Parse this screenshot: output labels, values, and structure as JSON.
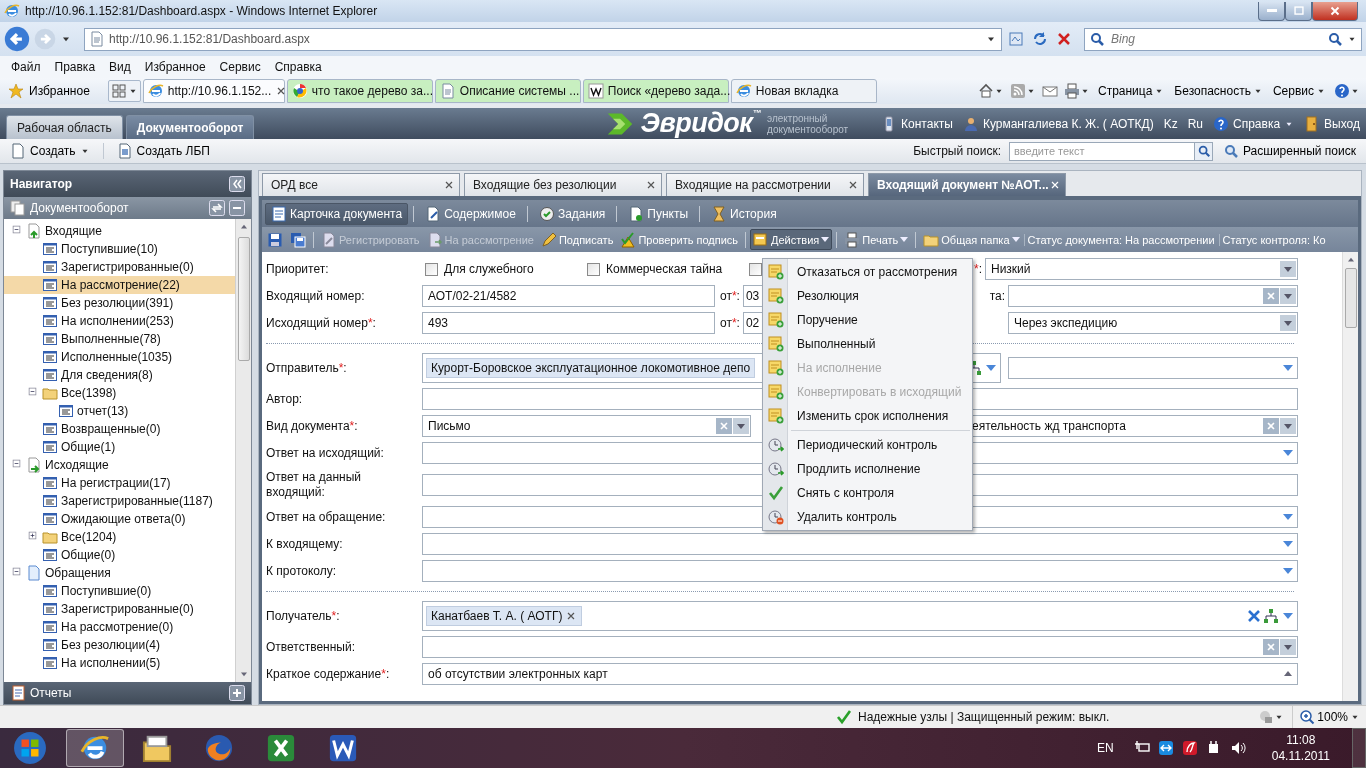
{
  "browser": {
    "title": "http://10.96.1.152:81/Dashboard.aspx - Windows Internet Explorer",
    "address": "http://10.96.1.152:81/Dashboard.aspx",
    "search_placeholder": "Bing",
    "menu": [
      "Файл",
      "Правка",
      "Вид",
      "Избранное",
      "Сервис",
      "Справка"
    ],
    "favorites": "Избранное",
    "tabs": [
      {
        "label": "http://10.96.1.152...",
        "selected": true,
        "kind": "ie"
      },
      {
        "label": "что такое дерево за...",
        "selected": false,
        "kind": "google",
        "color": "#c8efc0"
      },
      {
        "label": "Описание системы ...",
        "selected": false,
        "kind": "page",
        "color": "#c8efc0"
      },
      {
        "label": "Поиск «дерево зада...",
        "selected": false,
        "kind": "wiki",
        "color": "#c8efc0"
      },
      {
        "label": "Новая вкладка",
        "selected": false,
        "kind": "ie"
      }
    ],
    "commands": [
      "Страница",
      "Безопасность",
      "Сервис"
    ]
  },
  "app": {
    "tabs": [
      {
        "label": "Рабочая область",
        "selected": false
      },
      {
        "label": "Документооборот",
        "selected": true
      }
    ],
    "logo": {
      "name": "Эвридок$^{™}$",
      "tagline": "электронный документооборот"
    },
    "links": [
      {
        "label": "Контакты",
        "kind": "phone"
      },
      {
        "label": "Курмангалиева К. Ж. ( АОТКД)",
        "kind": "user"
      },
      {
        "label": "Kz",
        "kind": "lang"
      },
      {
        "label": "Ru",
        "kind": "lang"
      },
      {
        "label": "Справка",
        "kind": "help"
      },
      {
        "label": "Выход",
        "kind": "exit"
      }
    ],
    "toolbar": {
      "create": "Создать",
      "create_lbp": "Создать ЛБП",
      "quick_search_label": "Быстрый поиск:",
      "quick_search_placeholder": "введите текст",
      "advanced_search": "Расширенный поиск"
    }
  },
  "navigator": {
    "title": "Навигатор",
    "section": "Документооборот",
    "footer": "Отчеты",
    "tree": [
      {
        "label": "Входящие",
        "kind": "inbox",
        "selected": false,
        "expanded": true,
        "children": [
          {
            "label": "Поступившие(10)",
            "kind": "list",
            "selected": false
          },
          {
            "label": "Зарегистрированные(0)",
            "kind": "list",
            "selected": false
          },
          {
            "label": "На рассмотрение(22)",
            "kind": "list",
            "selected": true
          },
          {
            "label": "Без резолюции(391)",
            "kind": "list",
            "selected": false
          },
          {
            "label": "На исполнении(253)",
            "kind": "list",
            "selected": false
          },
          {
            "label": "Выполненные(78)",
            "kind": "list",
            "selected": false
          },
          {
            "label": "Исполненные(1035)",
            "kind": "list",
            "selected": false
          },
          {
            "label": "Для сведения(8)",
            "kind": "list",
            "selected": false
          },
          {
            "label": "Все(1398)",
            "kind": "folder",
            "selected": false,
            "expanded": true,
            "children": [
              {
                "label": "отчет(13)",
                "kind": "list",
                "selected": false
              }
            ]
          },
          {
            "label": "Возвращенные(0)",
            "kind": "list",
            "selected": false
          },
          {
            "label": "Общие(1)",
            "kind": "list",
            "selected": false
          }
        ]
      },
      {
        "label": "Исходящие",
        "kind": "outbox",
        "selected": false,
        "expanded": true,
        "children": [
          {
            "label": "На регистрации(17)",
            "kind": "list",
            "selected": false
          },
          {
            "label": "Зарегистрированные(1187)",
            "kind": "list",
            "selected": false
          },
          {
            "label": "Ожидающие ответа(0)",
            "kind": "list",
            "selected": false
          },
          {
            "label": "Все(1204)",
            "kind": "folder",
            "selected": false,
            "expanded": false
          },
          {
            "label": "Общие(0)",
            "kind": "list",
            "selected": false
          }
        ]
      },
      {
        "label": "Обращения",
        "kind": "appeals",
        "selected": false,
        "expanded": true,
        "children": [
          {
            "label": "Поступившие(0)",
            "kind": "list",
            "selected": false
          },
          {
            "label": "Зарегистрированные(0)",
            "kind": "list",
            "selected": false
          },
          {
            "label": "На рассмотрение(0)",
            "kind": "list",
            "selected": false
          },
          {
            "label": "Без резолюции(4)",
            "kind": "list",
            "selected": false
          },
          {
            "label": "На исполнении(5)",
            "kind": "list",
            "selected": false
          }
        ]
      }
    ]
  },
  "doc_tabs": [
    {
      "label": "ОРД все",
      "selected": false
    },
    {
      "label": "Входящие без резолюции",
      "selected": false
    },
    {
      "label": "Входящие на рассмотрении",
      "selected": false
    },
    {
      "label": "Входящий документ №АОТ...",
      "selected": true
    }
  ],
  "card_tabs": [
    {
      "label": "Карточка документа",
      "kind": "card",
      "selected": true
    },
    {
      "label": "Содержимое",
      "kind": "content",
      "selected": false
    },
    {
      "label": "Задания",
      "kind": "tasks",
      "selected": false
    },
    {
      "label": "Пункты",
      "kind": "points",
      "selected": false
    },
    {
      "label": "История",
      "kind": "history",
      "selected": false
    }
  ],
  "actions": [
    {
      "kind": "save"
    },
    {
      "kind": "save-all"
    },
    {
      "label": "Регистрировать",
      "kind": "register",
      "disabled": true
    },
    {
      "label": "На рассмотрение",
      "kind": "review",
      "disabled": true
    },
    {
      "label": "Подписать",
      "kind": "sign",
      "disabled": false
    },
    {
      "label": "Проверить подпись",
      "kind": "verify",
      "disabled": false
    },
    {
      "label": "Действия",
      "kind": "actions",
      "disabled": false,
      "pressed": true,
      "menu": true
    },
    {
      "label": "Печать",
      "kind": "print",
      "disabled": false,
      "pressed": false,
      "menu": true
    },
    {
      "label": "Общая папка",
      "kind": "folder",
      "disabled": false,
      "pressed": false,
      "menu": true
    }
  ],
  "statuses": [
    "Статус документа: На рассмотрении",
    "Статус контроля: Ко"
  ],
  "form": {
    "priority": {
      "label": "Приоритет:",
      "checkboxes": [
        {
          "label": "Для служебного",
          "checked": false
        },
        {
          "label": "Коммерческая тайна",
          "checked": false
        },
        {
          "checked": false
        }
      ],
      "side_mark": "*",
      "side_end": ":",
      "side_value": "Низкий"
    },
    "incoming": {
      "label": "Входящий номер:",
      "value": "АОТ/02-21/4582",
      "date_label": "от",
      "date_mark": "*",
      "date_end": ":",
      "date_value": "03",
      "side_label": "та:"
    },
    "outgoing": {
      "label": "Исходящий номер",
      "mark": "*",
      "end": ":",
      "value": "493",
      "date_label": "от",
      "date_mark": "*",
      "date_end": ":",
      "date_value": "02",
      "side_value": "Через экспедицию"
    },
    "fields": [
      {
        "kind": "sender",
        "label": "Отправитель",
        "mark": "*",
        "end": ":",
        "chip": "Курорт-Боровское эксплуатационное локомотивное депо"
      },
      {
        "kind": "text",
        "label": "Автор:"
      },
      {
        "kind": "split",
        "label": "Вид документа",
        "mark": "*",
        "end": ":",
        "value": "Письмо",
        "side_value": "еятельность жд транспорта"
      },
      {
        "kind": "select",
        "label": "Ответ на исходящий:"
      },
      {
        "kind": "text",
        "label": "Ответ на данный входящий:"
      },
      {
        "kind": "select",
        "label": "Ответ на обращение:"
      },
      {
        "kind": "select",
        "label": "К входящему:"
      },
      {
        "kind": "select",
        "label": "К протоколу:"
      },
      {
        "kind": "divider"
      },
      {
        "kind": "recipient",
        "label": "Получатель",
        "mark": "*",
        "end": ":",
        "chip": "Канатбаев Т. А. ( АОТГ)"
      },
      {
        "kind": "combo",
        "label": "Ответственный:"
      },
      {
        "kind": "memo",
        "label": "Краткое содержание",
        "mark": "*",
        "end": ":",
        "value": "об отсутствии электронных карт"
      }
    ]
  },
  "actions_menu": {
    "groups": [
      [
        {
          "label": "Отказаться от рассмотрения",
          "kind": "task",
          "disabled": false
        },
        {
          "label": "Резолюция",
          "kind": "task",
          "disabled": false
        },
        {
          "label": "Поручение",
          "kind": "task",
          "disabled": false
        },
        {
          "label": "Выполненный",
          "kind": "task",
          "disabled": false
        },
        {
          "label": "На исполнение",
          "kind": "task",
          "disabled": true
        },
        {
          "label": "Конвертировать в исходящий",
          "kind": "task",
          "disabled": true
        },
        {
          "label": "Изменить срок исполнения",
          "kind": "task",
          "disabled": false
        }
      ],
      [
        {
          "label": "Периодический контроль",
          "kind": "control",
          "disabled": false
        },
        {
          "label": "Продлить исполнение",
          "kind": "control",
          "disabled": false
        },
        {
          "label": "Снять с контроля",
          "kind": "check",
          "disabled": false
        },
        {
          "label": "Удалить контроль",
          "kind": "delete",
          "disabled": false
        }
      ]
    ]
  },
  "status_bar": {
    "zone": "Надежные узлы | Защищенный режим: выкл.",
    "zoom": "100%"
  },
  "taskbar": {
    "apps": [
      {
        "kind": "ie",
        "selected": true
      },
      {
        "kind": "explorer",
        "selected": false
      },
      {
        "kind": "firefox",
        "selected": false
      },
      {
        "kind": "excel",
        "selected": false
      },
      {
        "kind": "word",
        "selected": false
      }
    ],
    "language": "EN",
    "time": "11:08",
    "date": "04.11.2011"
  }
}
